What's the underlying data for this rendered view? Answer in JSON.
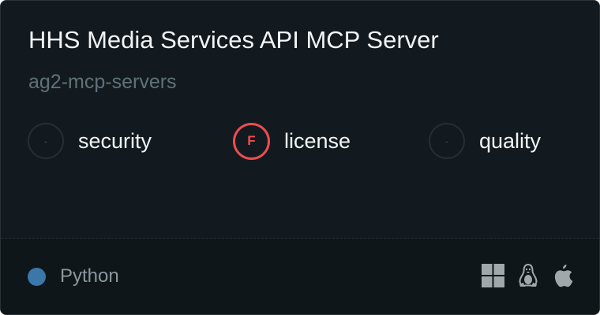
{
  "card": {
    "title": "HHS Media Services API MCP Server",
    "subtitle": "ag2-mcp-servers",
    "scores": [
      {
        "label": "security",
        "grade": "-",
        "status_color": "#262e33"
      },
      {
        "label": "license",
        "grade": "F",
        "status_color": "#ef4b4f"
      },
      {
        "label": "quality",
        "grade": "-",
        "status_color": "#262e33"
      }
    ],
    "language": {
      "name": "Python",
      "color": "#3b77a8"
    },
    "platforms": [
      "windows-icon",
      "linux-icon",
      "apple-icon"
    ]
  }
}
